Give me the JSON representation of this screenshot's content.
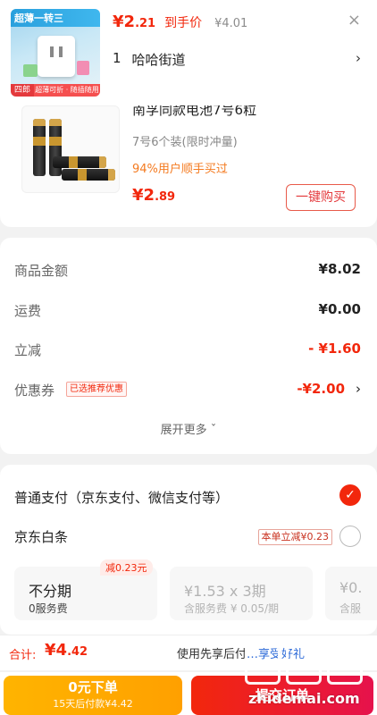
{
  "header": {
    "thumb_banner": "超薄一转三",
    "thumb_tag": "四郎",
    "thumb_foot": "超薄可折 · 随插随用",
    "price_symbol": "¥",
    "price_int": "2",
    "price_dec": ".21",
    "price_label": "到手价",
    "orig_price": "¥4.01",
    "close": "×",
    "qty": "1",
    "address": "哈哈街道",
    "arrow": "›"
  },
  "product": {
    "title": "南孚同款电池7号6粒",
    "spec": "7号6个装(限时冲量)",
    "tried": "94%用户顺手买过",
    "price_symbol": "¥",
    "price_int": "2",
    "price_dec": ".89",
    "buy_label": "一键购买"
  },
  "summary": {
    "rows": [
      {
        "label": "商品金额",
        "value": "¥8.02"
      },
      {
        "label": "运费",
        "value": "¥0.00"
      },
      {
        "label": "立减",
        "value": "- ¥1.60"
      },
      {
        "label": "优惠券",
        "value": "-¥2.00",
        "tag": "已选推荐优惠"
      }
    ],
    "coupon_arrow": "›",
    "expand": "展开更多 ˇ"
  },
  "payment": {
    "normal_label": "普通支付（京东支付、微信支付等）",
    "checked": "✓",
    "baitiao_label": "京东白条",
    "baitiao_tag": "本单立减¥0.23",
    "badge": "减0.23元",
    "plans": [
      {
        "main": "不分期",
        "sub": "0服务费"
      },
      {
        "main": "¥1.53 x 3期",
        "sub": "含服务费 ¥ 0.05/期"
      },
      {
        "main": "¥0.",
        "sub": "含服"
      }
    ]
  },
  "bottom": {
    "total_label": "合计:",
    "total_symbol": "¥",
    "total_int": "4",
    "total_dec": ".42",
    "hint_prefix": "使用先享后付",
    "hint_link": "…享受好礼",
    "btn_yellow_main": "0元下单",
    "btn_yellow_sub": "15天后付款¥4.42",
    "btn_red": "提交订单"
  },
  "watermark": {
    "text": "zhidemai.com"
  },
  "colors": {
    "accent": "#f2270c",
    "warning": "#ffa000",
    "link": "#2e6bd8"
  }
}
